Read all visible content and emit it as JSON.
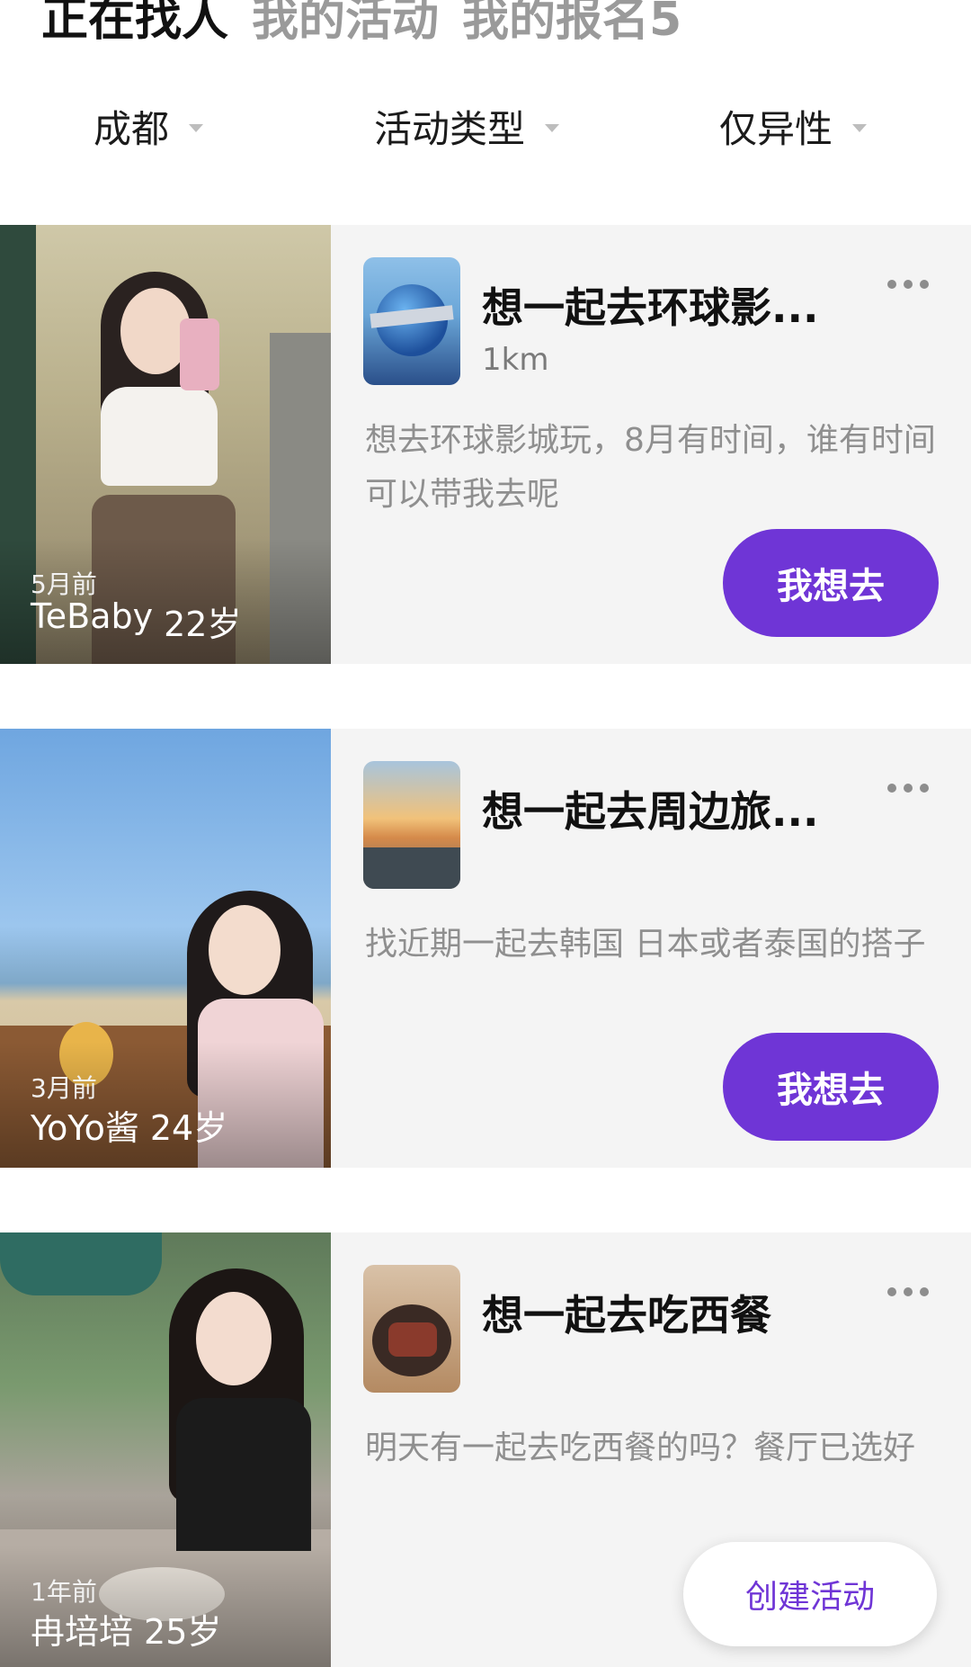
{
  "top_tabs": [
    {
      "label": "正在找人",
      "active": true
    },
    {
      "label": "我的活动",
      "active": false
    },
    {
      "label": "我的报名5",
      "active": false
    }
  ],
  "filters": {
    "city": "成都",
    "activity_type": "活动类型",
    "gender": "仅异性"
  },
  "cards": [
    {
      "time": "5月前",
      "user": "TeBaby",
      "age": "22岁",
      "title": "想一起去环球影...",
      "distance": "1km",
      "description": "想去环球影城玩，8月有时间，谁有时间可以带我去呢",
      "button": "我想去"
    },
    {
      "time": "3月前",
      "user": "YoYo酱",
      "age": "24岁",
      "title": "想一起去周边旅...",
      "distance": "",
      "description": "找近期一起去韩国 日本或者泰国的搭子",
      "button": "我想去"
    },
    {
      "time": "1年前",
      "user": "冉培培",
      "age": "25岁",
      "title": "想一起去吃西餐",
      "distance": "",
      "description": "明天有一起去吃西餐的吗？餐厅已选好",
      "button": ""
    }
  ],
  "create_button": "创建活动",
  "colors": {
    "accent": "#6f35d6",
    "card_bg": "#f4f4f4",
    "muted_text": "#8f8f8f"
  },
  "icons": [
    "caret-down-icon",
    "more-dots-icon"
  ]
}
